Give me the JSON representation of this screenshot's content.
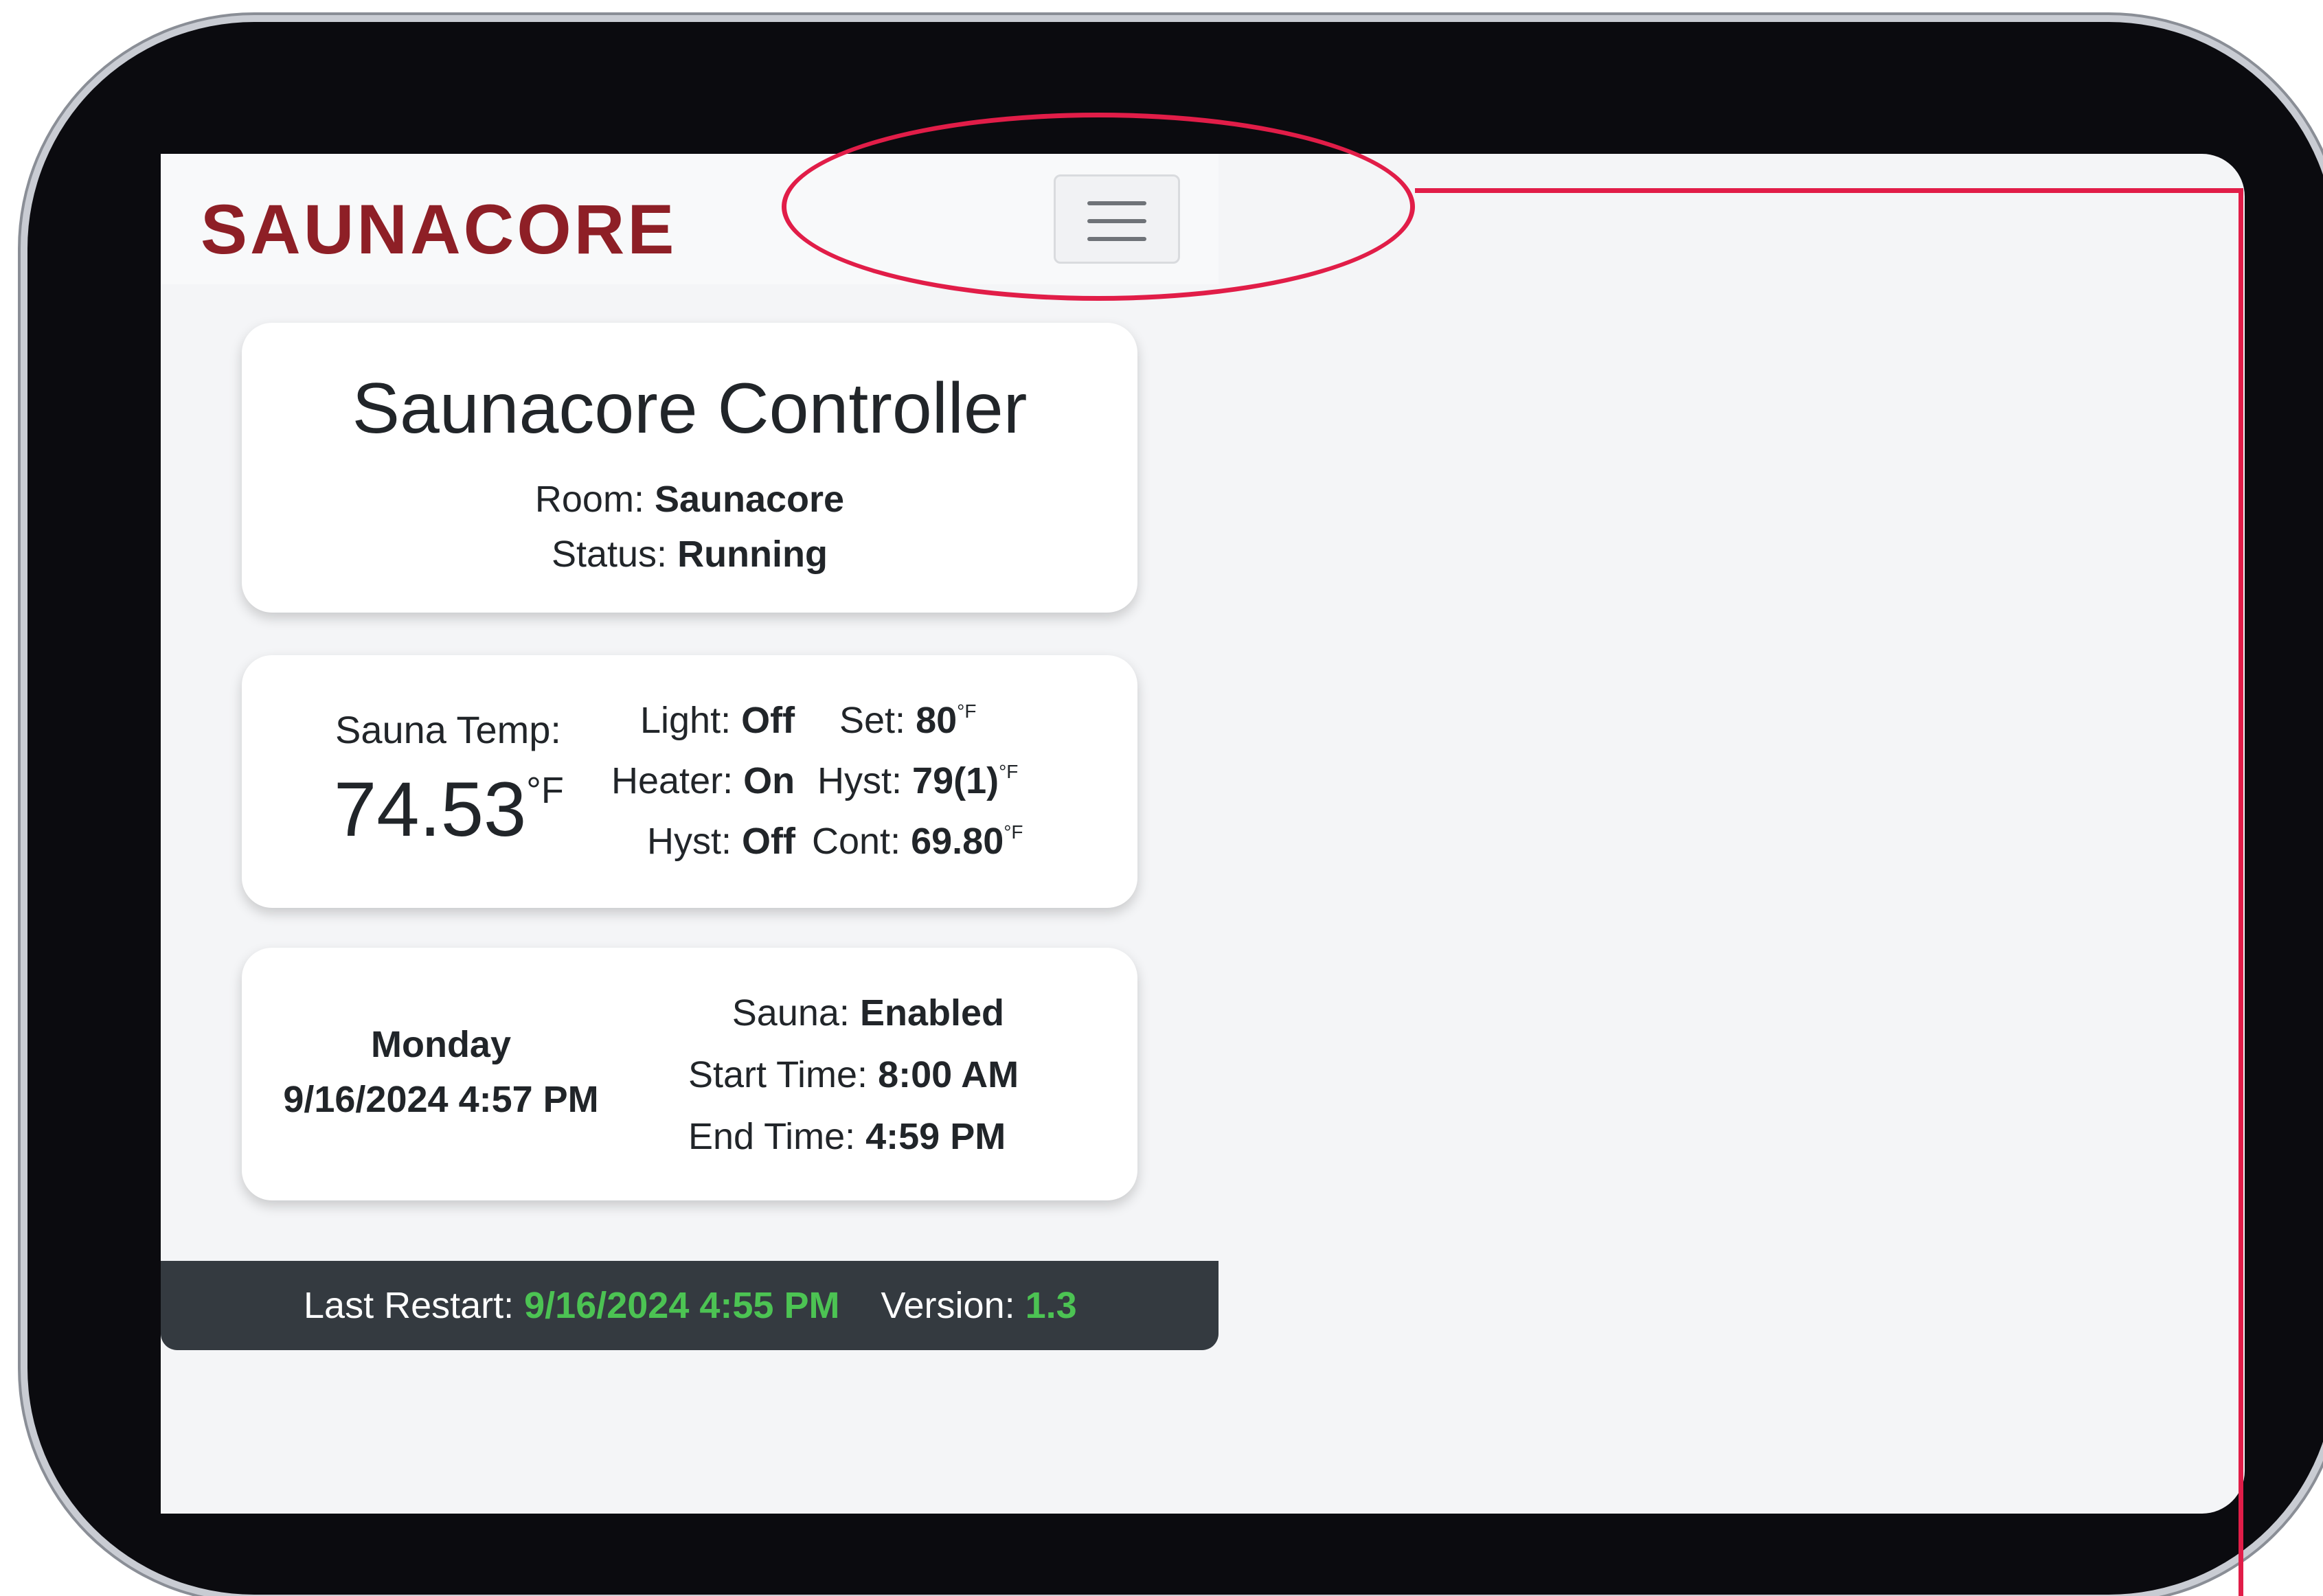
{
  "navbar": {
    "brand": "SAUNACORE",
    "menu_icon": "hamburger-menu-icon"
  },
  "header_card": {
    "title": "Saunacore Controller",
    "room_label": "Room:",
    "room_value": "Saunacore",
    "status_label": "Status:",
    "status_value": "Running"
  },
  "temp_card": {
    "sauna_temp_label": "Sauna Temp:",
    "sauna_temp_value": "74.53",
    "unit": "°F",
    "light_label": "Light:",
    "light_value": "Off",
    "set_label": "Set:",
    "set_value": "80",
    "heater_label": "Heater:",
    "heater_value": "On",
    "hyst_label": "Hyst:",
    "hyst_value": "79(1)",
    "hyst2_label": "Hyst:",
    "hyst2_value": "Off",
    "cont_label": "Cont:",
    "cont_value": "69.80"
  },
  "schedule_card": {
    "day": "Monday",
    "datetime": "9/16/2024 4:57 PM",
    "sauna_label": "Sauna:",
    "sauna_value": "Enabled",
    "start_label": "Start Time:",
    "start_value": "8:00 AM",
    "end_label": "End Time:",
    "end_value": "4:59 PM"
  },
  "footer": {
    "restart_label": "Last Restart:",
    "restart_value": "9/16/2024 4:55 PM",
    "version_label": "Version:",
    "version_value": "1.3"
  },
  "colors": {
    "brand": "#8e1f26",
    "footer_bg": "#343a40",
    "accent_green": "#4cc353",
    "callout": "#e11d48"
  }
}
